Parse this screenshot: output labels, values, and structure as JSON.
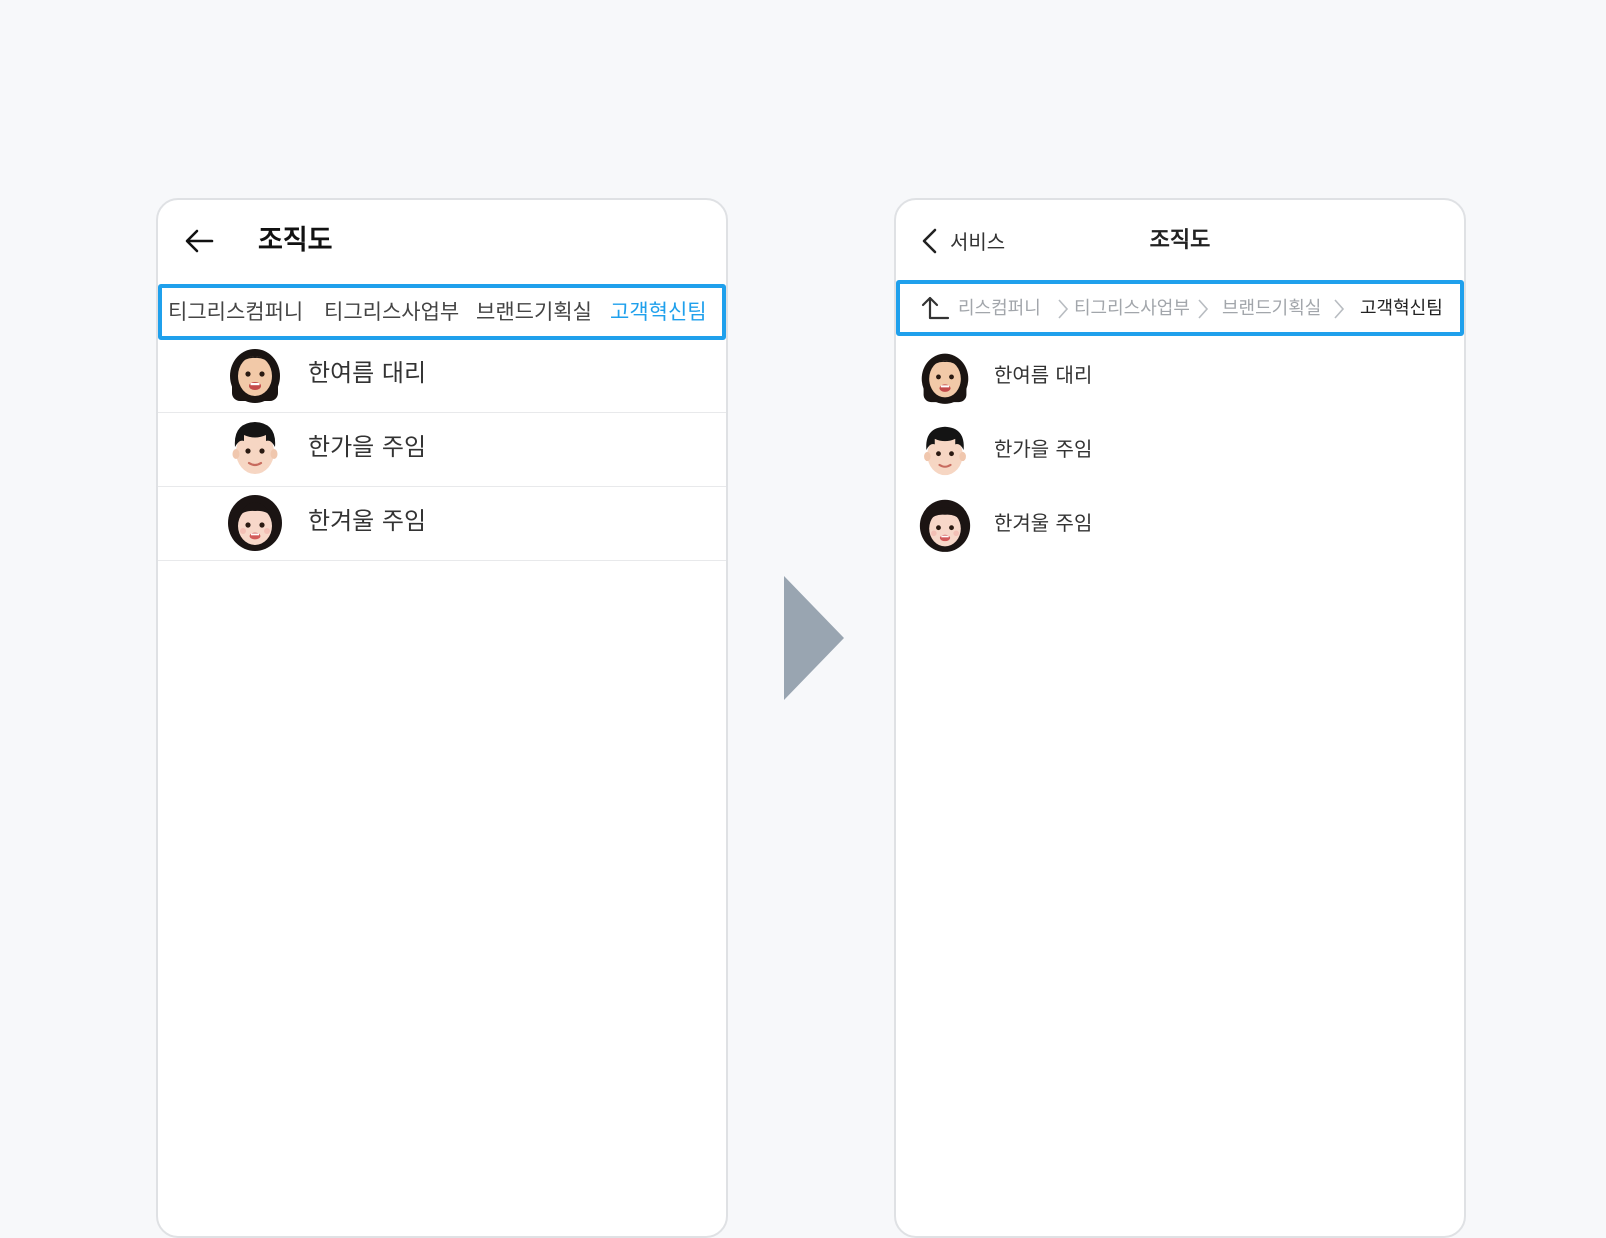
{
  "colors": {
    "accent": "#1fa0ec",
    "muted": "#a2a6ab",
    "flow_arrow": "#99a5b1"
  },
  "before": {
    "header": {
      "back_icon": "arrow-left-icon",
      "title": "조직도"
    },
    "path_tabs": [
      {
        "label": "티그리스컴퍼니",
        "active": false
      },
      {
        "label": "티그리스사업부",
        "active": false
      },
      {
        "label": "브랜드기획실",
        "active": false
      },
      {
        "label": "고객혁신팀",
        "active": true
      }
    ],
    "members": [
      {
        "name": "한여름 대리",
        "avatar": "avatar-memoji-woman-long-hair"
      },
      {
        "name": "한가을 주임",
        "avatar": "avatar-memoji-man-bangs"
      },
      {
        "name": "한겨울 주임",
        "avatar": "avatar-memoji-woman-bob"
      }
    ]
  },
  "after": {
    "header": {
      "back_icon": "chevron-left-icon",
      "back_label": "서비스",
      "title": "조직도"
    },
    "breadcrumb": {
      "up_icon": "level-up-icon",
      "items": [
        {
          "label": "리스컴퍼니",
          "current": false
        },
        {
          "label": "티그리스사업부",
          "current": false
        },
        {
          "label": "브랜드기획실",
          "current": false
        },
        {
          "label": "고객혁신팀",
          "current": true
        }
      ]
    },
    "members": [
      {
        "name": "한여름 대리",
        "avatar": "avatar-memoji-woman-long-hair"
      },
      {
        "name": "한가을 주임",
        "avatar": "avatar-memoji-man-bangs"
      },
      {
        "name": "한겨울 주임",
        "avatar": "avatar-memoji-woman-bob"
      }
    ]
  },
  "transition_icon": "triangle-right-icon"
}
